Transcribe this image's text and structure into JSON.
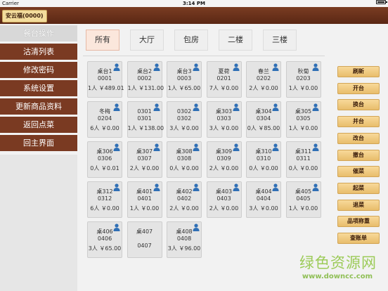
{
  "status_bar": {
    "carrier": "Carrier",
    "time": "3:14 PM",
    "battery_icon": "battery-icon"
  },
  "header": {
    "store_label": "安云福(0000)"
  },
  "sidebar": {
    "items": [
      {
        "label": "餐台操作",
        "active": true
      },
      {
        "label": "沽清列表",
        "active": false
      },
      {
        "label": "修改密码",
        "active": false
      },
      {
        "label": "系统设置",
        "active": false
      },
      {
        "label": "更新商品资料",
        "active": false
      },
      {
        "label": "返回点菜",
        "active": false
      },
      {
        "label": "回主界面",
        "active": false
      }
    ]
  },
  "area_tabs": [
    {
      "label": "所有",
      "active": true
    },
    {
      "label": "大厅",
      "active": false
    },
    {
      "label": "包房",
      "active": false
    },
    {
      "label": "二楼",
      "active": false
    },
    {
      "label": "三楼",
      "active": false
    }
  ],
  "tables": [
    {
      "name": "桌台1",
      "code": "0001",
      "info": "1人 ￥489.01",
      "occupied": true
    },
    {
      "name": "桌台2",
      "code": "0002",
      "info": "1人 ￥131.00",
      "occupied": true
    },
    {
      "name": "桌台3",
      "code": "0003",
      "info": "1人 ￥65.00",
      "occupied": true
    },
    {
      "name": "夏荷",
      "code": "0201",
      "info": "7人 ￥0.00",
      "occupied": true
    },
    {
      "name": "春兰",
      "code": "0202",
      "info": "2人 ￥0.00",
      "occupied": true
    },
    {
      "name": "秋菊",
      "code": "0203",
      "info": "1人 ￥0.00",
      "occupied": true
    },
    {
      "name": "冬梅",
      "code": "0204",
      "info": "6人 ￥0.00",
      "occupied": true
    },
    {
      "name": "0301",
      "code": "0301",
      "info": "1人 ￥138.00",
      "occupied": true
    },
    {
      "name": "0302",
      "code": "0302",
      "info": "3人 ￥0.00",
      "occupied": true
    },
    {
      "name": "桌303",
      "code": "0303",
      "info": "3人 ￥0.00",
      "occupied": true
    },
    {
      "name": "桌304",
      "code": "0304",
      "info": "0人 ￥85.00",
      "occupied": true
    },
    {
      "name": "桌305",
      "code": "0305",
      "info": "1人 ￥0.00",
      "occupied": true
    },
    {
      "name": "桌306",
      "code": "0306",
      "info": "0人 ￥0.01",
      "occupied": true
    },
    {
      "name": "桌307",
      "code": "0307",
      "info": "2人 ￥0.00",
      "occupied": true
    },
    {
      "name": "桌308",
      "code": "0308",
      "info": "0人 ￥0.00",
      "occupied": true
    },
    {
      "name": "桌309",
      "code": "0309",
      "info": "2人 ￥0.00",
      "occupied": true
    },
    {
      "name": "桌310",
      "code": "0310",
      "info": "0人 ￥0.00",
      "occupied": true
    },
    {
      "name": "桌311",
      "code": "0311",
      "info": "0人 ￥0.00",
      "occupied": true
    },
    {
      "name": "桌312",
      "code": "0312",
      "info": "6人 ￥0.00",
      "occupied": true
    },
    {
      "name": "桌401",
      "code": "0401",
      "info": "1人 ￥0.00",
      "occupied": true
    },
    {
      "name": "桌402",
      "code": "0402",
      "info": "2人 ￥0.00",
      "occupied": true
    },
    {
      "name": "桌403",
      "code": "0403",
      "info": "2人 ￥0.00",
      "occupied": true
    },
    {
      "name": "桌404",
      "code": "0404",
      "info": "3人 ￥0.00",
      "occupied": true
    },
    {
      "name": "桌405",
      "code": "0405",
      "info": "1人 ￥0.00",
      "occupied": true
    },
    {
      "name": "桌406",
      "code": "0406",
      "info": "3人 ￥65.00",
      "occupied": true
    },
    {
      "name": "桌407",
      "code": "0407",
      "info": "",
      "occupied": false
    },
    {
      "name": "桌408",
      "code": "0408",
      "info": "3人 ￥96.00",
      "occupied": true
    }
  ],
  "actions": [
    "刷新",
    "开台",
    "换台",
    "并台",
    "改台",
    "撤台",
    "催菜",
    "起菜",
    "退菜",
    "品项称重",
    "查账单"
  ],
  "watermark": {
    "title": "绿色资源网",
    "url": "www.downcc.com"
  },
  "colors": {
    "header": "#6a2f1a",
    "sidebar_item": "#7a3a22",
    "action_button": "#efc87c",
    "active_tab": "#fbe7dc"
  }
}
